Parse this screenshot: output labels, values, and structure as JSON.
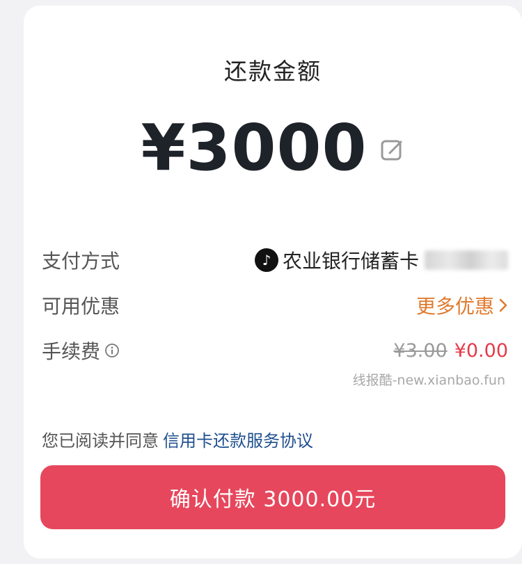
{
  "header": {
    "title": "还款金额"
  },
  "amount": {
    "value": "¥3000",
    "edit_icon": "edit-icon"
  },
  "rows": {
    "payment_method": {
      "label": "支付方式",
      "value": "农业银行储蓄卡",
      "logo_icon": "tiktok-logo-icon"
    },
    "discounts": {
      "label": "可用优惠",
      "value": "更多优惠",
      "icon": "chevron-right-icon"
    },
    "fee": {
      "label": "手续费",
      "info_icon": "info-icon",
      "original": "¥3.00",
      "current": "¥0.00"
    }
  },
  "watermark": "线报酷-new.xianbao.fun",
  "agreement": {
    "prefix": "您已阅读并同意",
    "link": "信用卡还款服务协议"
  },
  "confirm_button": {
    "label": "确认付款 3000.00元"
  },
  "colors": {
    "accent": "#e6475c",
    "promo": "#e07a2e",
    "link": "#1f4f8f",
    "fee_current": "#e53a4b"
  }
}
